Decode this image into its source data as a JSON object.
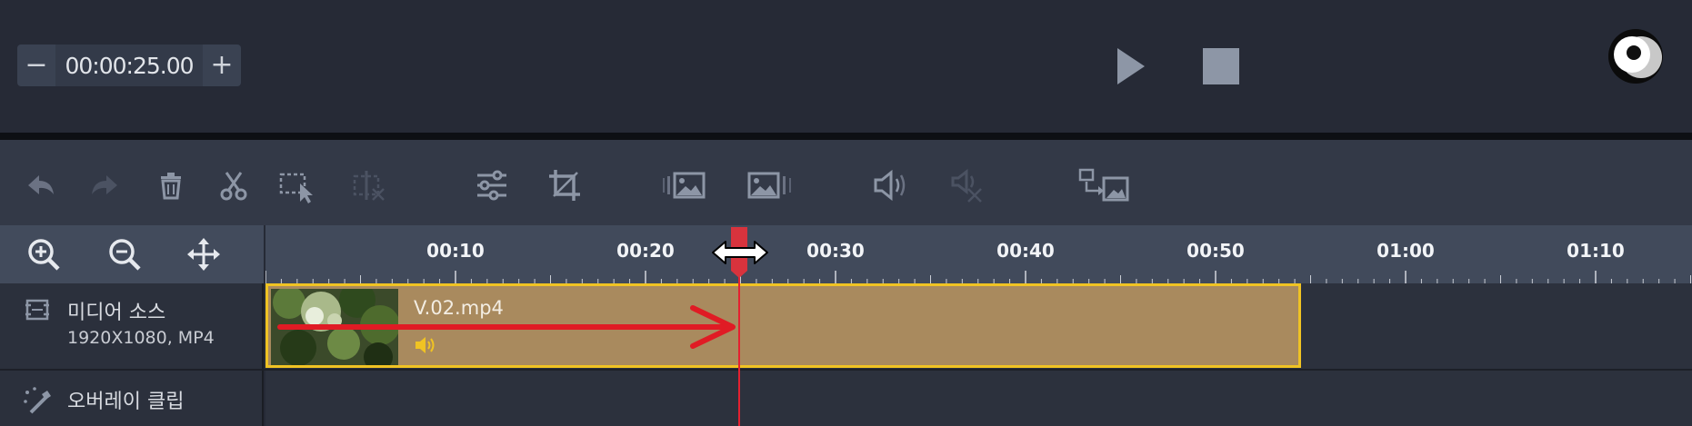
{
  "playback": {
    "time_value": "00:00:25.00",
    "minus_label": "−",
    "plus_label": "+"
  },
  "toolbar": {
    "tools": [
      "undo-icon",
      "redo-icon",
      "delete-icon",
      "cut-icon",
      "select-icon",
      "split-icon",
      "adjust-icon",
      "crop-icon",
      "fade-in-image-icon",
      "fade-out-image-icon",
      "volume-icon",
      "mute-cut-icon",
      "replace-media-icon"
    ]
  },
  "ruler": {
    "labels": [
      "00:10",
      "00:20",
      "00:30",
      "00:40",
      "00:50",
      "01:00",
      "01:10"
    ]
  },
  "tracks": {
    "media": {
      "title": "미디어 소스",
      "subtitle": "1920X1080, MP4"
    },
    "overlay": {
      "title": "오버레이 클립"
    }
  },
  "clip": {
    "name": "V.02.mp4"
  },
  "colors": {
    "accent": "#f0c323",
    "playhead": "#e52030",
    "clip_fill": "#a98a5e"
  }
}
